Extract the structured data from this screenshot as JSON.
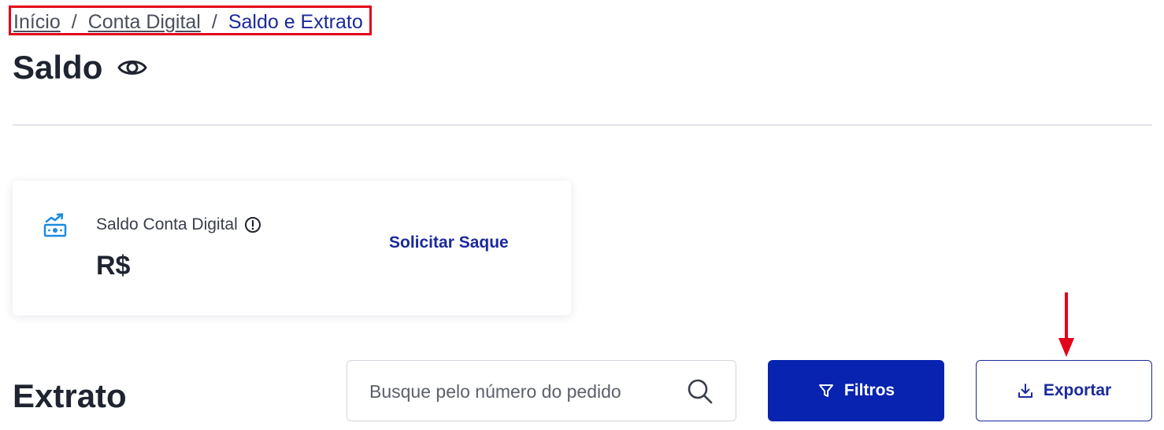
{
  "breadcrumb": {
    "items": [
      {
        "label": "Início"
      },
      {
        "label": "Conta Digital"
      },
      {
        "label": "Saldo e Extrato"
      }
    ],
    "separator": "/"
  },
  "header": {
    "title": "Saldo",
    "visibility_icon": "eye-icon"
  },
  "balance_card": {
    "icon": "money-icon",
    "label": "Saldo Conta Digital",
    "info_icon": "info-icon",
    "currency": "R$",
    "amount": "",
    "withdraw_label": "Solicitar Saque"
  },
  "statement": {
    "title": "Extrato",
    "search": {
      "placeholder": "Busque pelo número do pedido",
      "value": ""
    },
    "filters_label": "Filtros",
    "export_label": "Exportar"
  },
  "colors": {
    "primary": "#0723b0",
    "link": "#1b2a9a",
    "annotation": "#e3001b",
    "money_icon": "#1a8be0"
  }
}
